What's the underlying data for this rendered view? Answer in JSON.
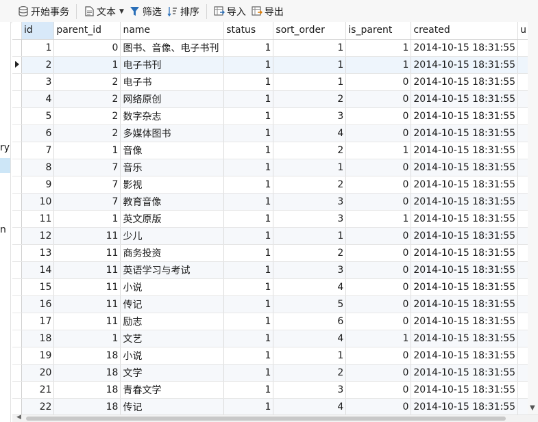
{
  "toolbar": {
    "begin_tx": "开始事务",
    "text": "文本",
    "filter": "筛选",
    "sort": "排序",
    "import": "导入",
    "export": "导出"
  },
  "left_pane": {
    "frag1": "ry",
    "frag2": "n"
  },
  "table": {
    "columns": [
      "id",
      "parent_id",
      "name",
      "status",
      "sort_order",
      "is_parent",
      "created",
      "u"
    ],
    "rows": [
      {
        "id": "1",
        "parent_id": "0",
        "name": "图书、音像、电子书刊",
        "status": "1",
        "sort_order": "1",
        "is_parent": "1",
        "created": "2014-10-15 18:31:55"
      },
      {
        "id": "2",
        "parent_id": "1",
        "name": "电子书刊",
        "status": "1",
        "sort_order": "1",
        "is_parent": "1",
        "created": "2014-10-15 18:31:55"
      },
      {
        "id": "3",
        "parent_id": "2",
        "name": "电子书",
        "status": "1",
        "sort_order": "1",
        "is_parent": "0",
        "created": "2014-10-15 18:31:55"
      },
      {
        "id": "4",
        "parent_id": "2",
        "name": "网络原创",
        "status": "1",
        "sort_order": "2",
        "is_parent": "0",
        "created": "2014-10-15 18:31:55"
      },
      {
        "id": "5",
        "parent_id": "2",
        "name": "数字杂志",
        "status": "1",
        "sort_order": "3",
        "is_parent": "0",
        "created": "2014-10-15 18:31:55"
      },
      {
        "id": "6",
        "parent_id": "2",
        "name": "多媒体图书",
        "status": "1",
        "sort_order": "4",
        "is_parent": "0",
        "created": "2014-10-15 18:31:55"
      },
      {
        "id": "7",
        "parent_id": "1",
        "name": "音像",
        "status": "1",
        "sort_order": "2",
        "is_parent": "1",
        "created": "2014-10-15 18:31:55"
      },
      {
        "id": "8",
        "parent_id": "7",
        "name": "音乐",
        "status": "1",
        "sort_order": "1",
        "is_parent": "0",
        "created": "2014-10-15 18:31:55"
      },
      {
        "id": "9",
        "parent_id": "7",
        "name": "影视",
        "status": "1",
        "sort_order": "2",
        "is_parent": "0",
        "created": "2014-10-15 18:31:55"
      },
      {
        "id": "10",
        "parent_id": "7",
        "name": "教育音像",
        "status": "1",
        "sort_order": "3",
        "is_parent": "0",
        "created": "2014-10-15 18:31:55"
      },
      {
        "id": "11",
        "parent_id": "1",
        "name": "英文原版",
        "status": "1",
        "sort_order": "3",
        "is_parent": "1",
        "created": "2014-10-15 18:31:55"
      },
      {
        "id": "12",
        "parent_id": "11",
        "name": "少儿",
        "status": "1",
        "sort_order": "1",
        "is_parent": "0",
        "created": "2014-10-15 18:31:55"
      },
      {
        "id": "13",
        "parent_id": "11",
        "name": "商务投资",
        "status": "1",
        "sort_order": "2",
        "is_parent": "0",
        "created": "2014-10-15 18:31:55"
      },
      {
        "id": "14",
        "parent_id": "11",
        "name": "英语学习与考试",
        "status": "1",
        "sort_order": "3",
        "is_parent": "0",
        "created": "2014-10-15 18:31:55"
      },
      {
        "id": "15",
        "parent_id": "11",
        "name": "小说",
        "status": "1",
        "sort_order": "4",
        "is_parent": "0",
        "created": "2014-10-15 18:31:55"
      },
      {
        "id": "16",
        "parent_id": "11",
        "name": "传记",
        "status": "1",
        "sort_order": "5",
        "is_parent": "0",
        "created": "2014-10-15 18:31:55"
      },
      {
        "id": "17",
        "parent_id": "11",
        "name": "励志",
        "status": "1",
        "sort_order": "6",
        "is_parent": "0",
        "created": "2014-10-15 18:31:55"
      },
      {
        "id": "18",
        "parent_id": "1",
        "name": "文艺",
        "status": "1",
        "sort_order": "4",
        "is_parent": "1",
        "created": "2014-10-15 18:31:55"
      },
      {
        "id": "19",
        "parent_id": "18",
        "name": "小说",
        "status": "1",
        "sort_order": "1",
        "is_parent": "0",
        "created": "2014-10-15 18:31:55"
      },
      {
        "id": "20",
        "parent_id": "18",
        "name": "文学",
        "status": "1",
        "sort_order": "2",
        "is_parent": "0",
        "created": "2014-10-15 18:31:55"
      },
      {
        "id": "21",
        "parent_id": "18",
        "name": "青春文学",
        "status": "1",
        "sort_order": "3",
        "is_parent": "0",
        "created": "2014-10-15 18:31:55"
      },
      {
        "id": "22",
        "parent_id": "18",
        "name": "传记",
        "status": "1",
        "sort_order": "4",
        "is_parent": "0",
        "created": "2014-10-15 18:31:55"
      }
    ],
    "selected_row": 2
  },
  "colors": {
    "header_selected": "#d8e9f9",
    "row_alt": "#f6f8fb",
    "toolbar_bg": "#f7f7f7",
    "icon_blue": "#2a6fb8"
  }
}
